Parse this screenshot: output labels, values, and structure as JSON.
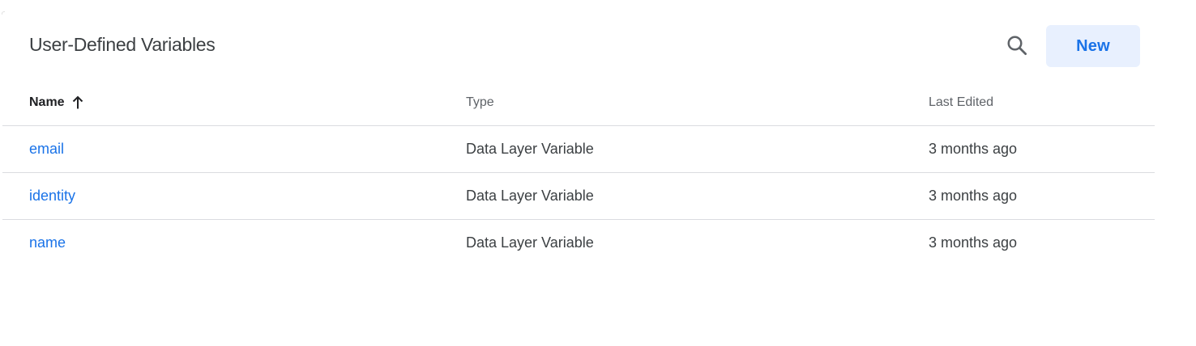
{
  "header": {
    "title": "User-Defined Variables",
    "search_icon": "search-icon",
    "new_button_label": "New"
  },
  "table": {
    "columns": {
      "name": "Name",
      "type": "Type",
      "last_edited": "Last Edited"
    },
    "sort": {
      "column": "name",
      "direction": "ascending",
      "icon": "arrow-up-icon"
    },
    "rows": [
      {
        "name": "email",
        "type": "Data Layer Variable",
        "last_edited": "3 months ago"
      },
      {
        "name": "identity",
        "type": "Data Layer Variable",
        "last_edited": "3 months ago"
      },
      {
        "name": "name",
        "type": "Data Layer Variable",
        "last_edited": "3 months ago"
      }
    ]
  },
  "colors": {
    "accent": "#1a73e8",
    "button_bg": "#e8f0fe",
    "divider": "#dadce0",
    "text": "#3c4043"
  }
}
